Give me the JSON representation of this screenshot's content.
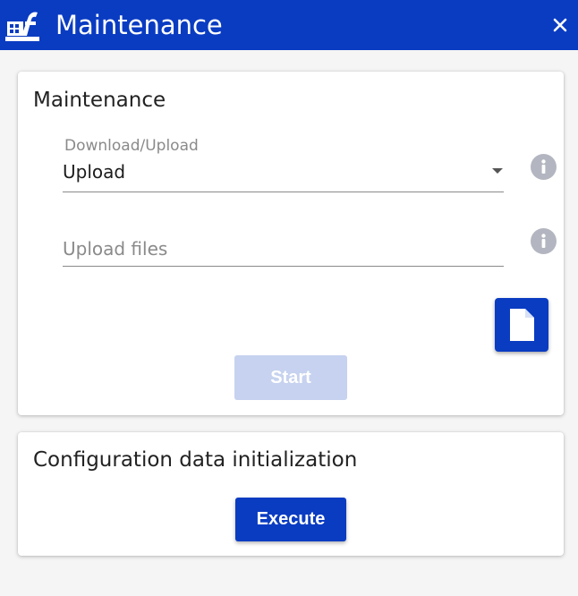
{
  "header": {
    "title": "Maintenance",
    "logo_icon": "app-logo-icon",
    "close_icon": "close-icon",
    "background_color": "#0a3cc2"
  },
  "maintenance_card": {
    "title": "Maintenance",
    "download_upload": {
      "label": "Download/Upload",
      "selected_value": "Upload",
      "info_icon": "info-icon"
    },
    "upload_files": {
      "placeholder": "Upload files",
      "value": "",
      "info_icon": "info-icon"
    },
    "file_button_icon": "file-icon",
    "start_button": {
      "label": "Start",
      "disabled": true,
      "color": "#c6d2ef"
    }
  },
  "config_card": {
    "title": "Configuration data initialization",
    "execute_button": {
      "label": "Execute",
      "color": "#0a3cc2"
    }
  }
}
